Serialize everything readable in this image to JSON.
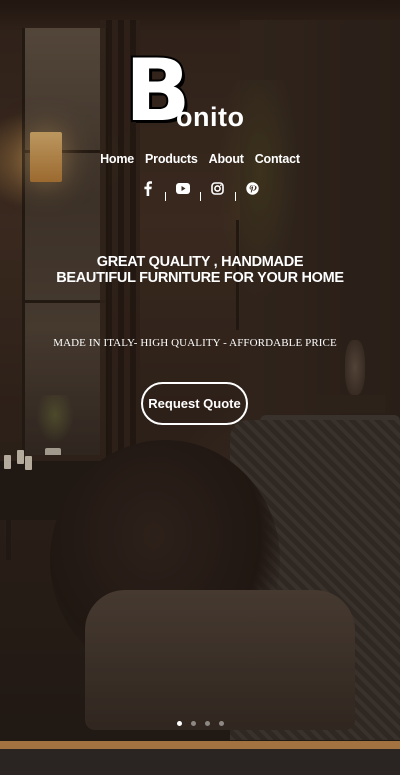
{
  "brand": {
    "initial": "B",
    "rest": "onito"
  },
  "nav": [
    {
      "label": "Home"
    },
    {
      "label": "Products"
    },
    {
      "label": "About"
    },
    {
      "label": "Contact"
    }
  ],
  "social": [
    {
      "icon": "facebook-icon"
    },
    {
      "icon": "youtube-icon"
    },
    {
      "icon": "instagram-icon"
    },
    {
      "icon": "pinterest-icon"
    }
  ],
  "hero": {
    "headline_line1": "GREAT QUALITY , HANDMADE",
    "headline_line2": "BEAUTIFUL FURNITURE FOR YOUR HOME",
    "tagline": "MADE IN ITALY- HIGH QUALITY - AFFORDABLE PRICE",
    "cta_label": "Request Quote"
  },
  "slider": {
    "count": 4,
    "active": 1
  },
  "colors": {
    "text": "#ffffff",
    "accent_strip": "#a27240"
  }
}
